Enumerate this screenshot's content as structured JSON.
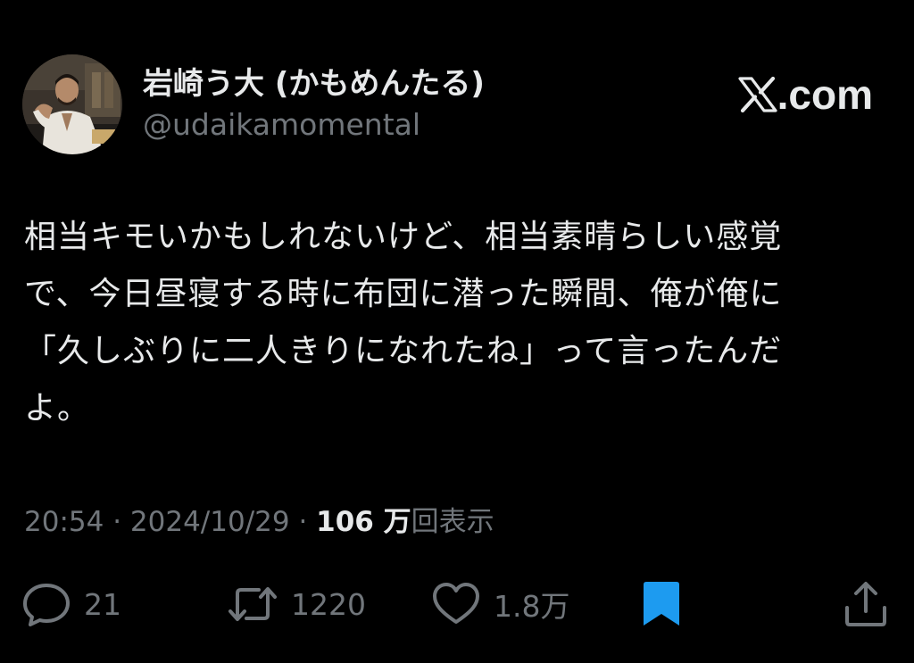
{
  "author": {
    "display_name": "岩崎う大 (かもめんたる)",
    "handle": "@udaikamomental"
  },
  "brand": {
    "label": "com",
    "logo_icon": "x-logo-icon"
  },
  "tweet": {
    "lines": [
      "相当キモいかもしれないけど、相当素晴らしい感覚",
      "で、今日昼寝する時に布団に潜った瞬間、俺が俺に",
      "「久しぶりに二人きりになれたね」って言ったんだ",
      "よ。"
    ]
  },
  "meta": {
    "time": "20:54",
    "separator": " · ",
    "date": "2024/10/29",
    "views_count": "106 万",
    "views_label": "回表示"
  },
  "actions": {
    "reply_count": "21",
    "repost_count": "1220",
    "like_count": "1.8万"
  },
  "colors": {
    "background": "#000000",
    "primary_text": "#e7e9ea",
    "secondary_text": "#71767b",
    "bookmark_active": "#1d9bf0"
  }
}
